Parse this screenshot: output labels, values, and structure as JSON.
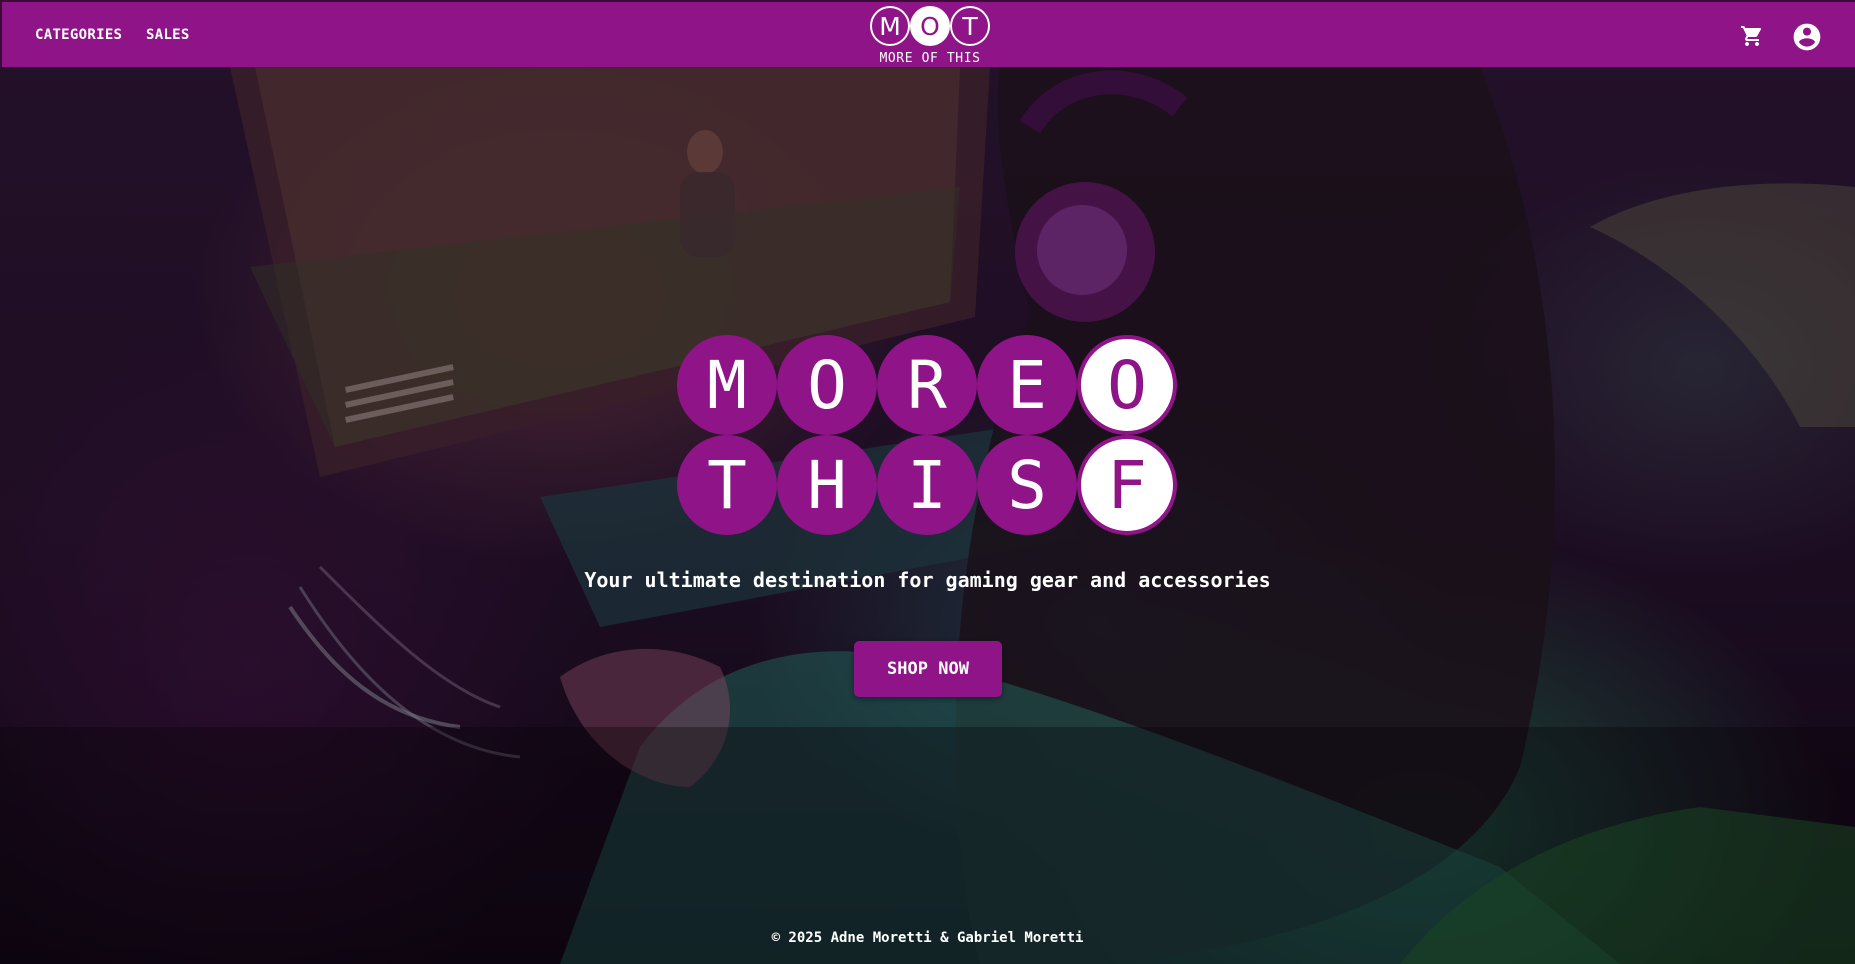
{
  "header": {
    "nav": [
      {
        "label": "CATEGORIES"
      },
      {
        "label": "SALES"
      }
    ],
    "brand": {
      "letters": [
        "M",
        "O",
        "T"
      ],
      "tagline": "MORE OF THIS"
    },
    "icons": {
      "cart": "shopping-cart-icon",
      "account": "account-circle-icon"
    }
  },
  "hero": {
    "logo": {
      "row1": [
        "M",
        "O",
        "R",
        "E",
        "O"
      ],
      "row2": [
        "T",
        "H",
        "I",
        "S",
        "F"
      ]
    },
    "subtitle": "Your ultimate destination for gaming gear and accessories",
    "cta_label": "SHOP NOW"
  },
  "footer": {
    "copyright": "© 2025 Adne Moretti & Gabriel Moretti"
  },
  "colors": {
    "brand": "#8e1487",
    "text": "#ffffff"
  }
}
